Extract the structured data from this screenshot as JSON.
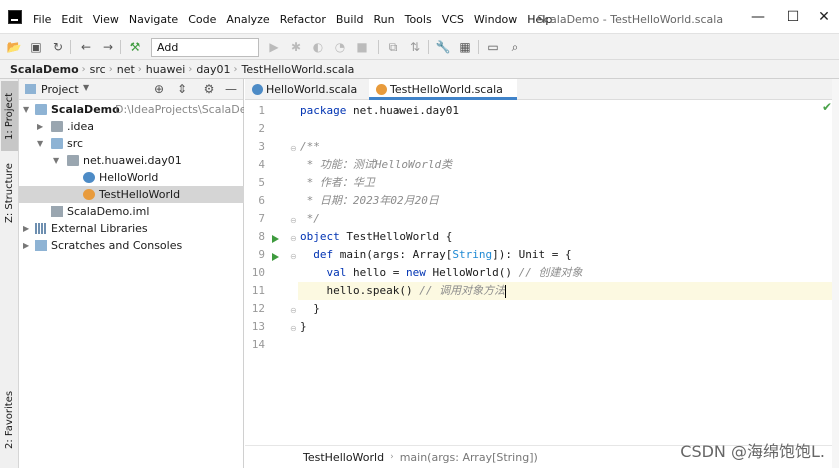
{
  "menu": [
    "File",
    "Edit",
    "View",
    "Navigate",
    "Code",
    "Analyze",
    "Refactor",
    "Build",
    "Run",
    "Tools",
    "VCS",
    "Window",
    "Help"
  ],
  "window_title": "ScalaDemo - TestHelloWorld.scala",
  "window_controls": {
    "minimize": "—",
    "maximize": "☐",
    "close": "✕"
  },
  "toolbar": {
    "run_config": "Add Configuration..."
  },
  "breadcrumb": [
    "ScalaDemo",
    "src",
    "net",
    "huawei",
    "day01",
    "TestHelloWorld.scala"
  ],
  "side_tabs": {
    "project": "1: Project",
    "structure": "Z: Structure",
    "favorites": "2: Favorites"
  },
  "project_panel": {
    "title": "Project",
    "tree": [
      {
        "label": "ScalaDemo",
        "extra": "D:\\IdeaProjects\\ScalaDemo",
        "bold": true
      },
      {
        "label": ".idea"
      },
      {
        "label": "src"
      },
      {
        "label": "net.huawei.day01"
      },
      {
        "label": "HelloWorld"
      },
      {
        "label": "TestHelloWorld"
      },
      {
        "label": "ScalaDemo.iml"
      },
      {
        "label": "External Libraries"
      },
      {
        "label": "Scratches and Consoles"
      }
    ]
  },
  "tabs": [
    {
      "label": "HelloWorld.scala",
      "close": "×"
    },
    {
      "label": "TestHelloWorld.scala",
      "close": "×"
    }
  ],
  "code": {
    "line_numbers": [
      "1",
      "2",
      "3",
      "4",
      "5",
      "6",
      "7",
      "8",
      "9",
      "10",
      "11",
      "12",
      "13",
      "14"
    ],
    "l1_kw": "package",
    "l1_rest": " net.huawei.day01",
    "l3": "/**",
    "l4": " * 功能：测试HelloWorld类",
    "l5": " * 作者：华卫",
    "l6": " * 日期：2023年02月20日",
    "l7": " */",
    "l8_kw": "object",
    "l8_rest": " TestHelloWorld {",
    "l9_indent": "  ",
    "l9_kw": "def",
    "l9_a": " main(args: Array[",
    "l9_type": "String",
    "l9_b": "]): Unit = {",
    "l10_indent": "    ",
    "l10_kw1": "val",
    "l10_a": " hello = ",
    "l10_kw2": "new",
    "l10_b": " HelloWorld() ",
    "l10_cmt": "// 创建对象",
    "l11_a": "    hello.speak() ",
    "l11_cmt": "// 调用对象方法",
    "l12": "  }",
    "l13": "}"
  },
  "editor_breadcrumb": [
    "TestHelloWorld",
    "main(args: Array[String])"
  ],
  "watermark": "CSDN @海绵饱饱L."
}
